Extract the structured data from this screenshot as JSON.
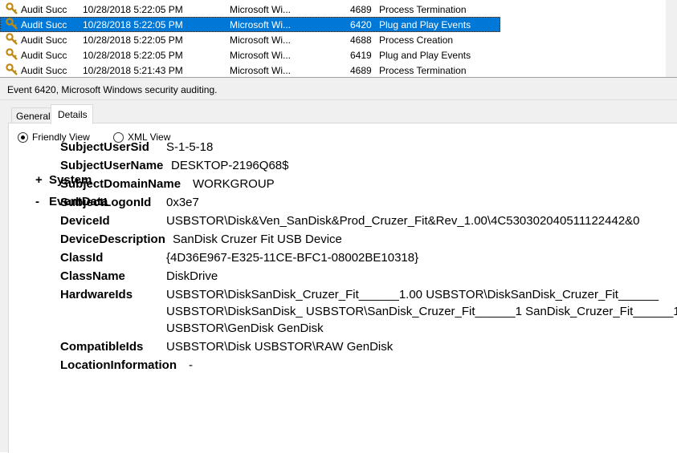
{
  "event_list": {
    "rows": [
      {
        "keyword": "Audit Succ",
        "datetime": "10/28/2018 5:22:05 PM",
        "source": "Microsoft Wi...",
        "event_id": "4689",
        "task": "Process Termination",
        "selected": false
      },
      {
        "keyword": "Audit Succ",
        "datetime": "10/28/2018 5:22:05 PM",
        "source": "Microsoft Wi...",
        "event_id": "6420",
        "task": "Plug and Play Events",
        "selected": true
      },
      {
        "keyword": "Audit Succ",
        "datetime": "10/28/2018 5:22:05 PM",
        "source": "Microsoft Wi...",
        "event_id": "4688",
        "task": "Process Creation",
        "selected": false
      },
      {
        "keyword": "Audit Succ",
        "datetime": "10/28/2018 5:22:05 PM",
        "source": "Microsoft Wi...",
        "event_id": "6419",
        "task": "Plug and Play Events",
        "selected": false
      },
      {
        "keyword": "Audit Succ",
        "datetime": "10/28/2018 5:21:43 PM",
        "source": "Microsoft Wi...",
        "event_id": "4689",
        "task": "Process Termination",
        "selected": false
      }
    ],
    "row_icon": "key-icon",
    "selection_color": "#0078d7"
  },
  "details": {
    "header": "Event 6420, Microsoft Windows security auditing.",
    "tabs": {
      "general": "General",
      "details": "Details"
    },
    "radio": {
      "friendly": "Friendly View",
      "xml": "XML View",
      "selected": "friendly"
    },
    "tree": {
      "system": {
        "symbol": "+",
        "title": "System"
      },
      "eventdata": {
        "symbol": "-",
        "title": "EventData"
      }
    },
    "fields": [
      {
        "name": "SubjectUserSid",
        "value": [
          "S-1-5-18"
        ]
      },
      {
        "name": "SubjectUserName",
        "value": [
          "DESKTOP-2196Q68$"
        ]
      },
      {
        "name": "SubjectDomainName",
        "value": [
          "WORKGROUP"
        ]
      },
      {
        "name": "SubjectLogonId",
        "value": [
          "0x3e7"
        ]
      },
      {
        "name": "DeviceId",
        "value": [
          "USBSTOR\\Disk&Ven_SanDisk&Prod_Cruzer_Fit&Rev_1.00\\4C530302040511122442&0"
        ]
      },
      {
        "name": "DeviceDescription",
        "value": [
          "SanDisk Cruzer Fit USB Device"
        ]
      },
      {
        "name": "ClassId",
        "value": [
          "{4D36E967-E325-11CE-BFC1-08002BE10318}"
        ]
      },
      {
        "name": "ClassName",
        "value": [
          "DiskDrive"
        ]
      },
      {
        "name": "HardwareIds",
        "value": [
          "USBSTOR\\DiskSanDisk_Cruzer_Fit______1.00 USBSTOR\\DiskSanDisk_Cruzer_Fit______",
          "USBSTOR\\DiskSanDisk_ USBSTOR\\SanDisk_Cruzer_Fit______1 SanDisk_Cruzer_Fit______1",
          "USBSTOR\\GenDisk GenDisk"
        ]
      },
      {
        "name": "CompatibleIds",
        "value": [
          "USBSTOR\\Disk USBSTOR\\RAW GenDisk"
        ]
      },
      {
        "name": "LocationInformation",
        "value": [
          "-"
        ]
      }
    ]
  }
}
